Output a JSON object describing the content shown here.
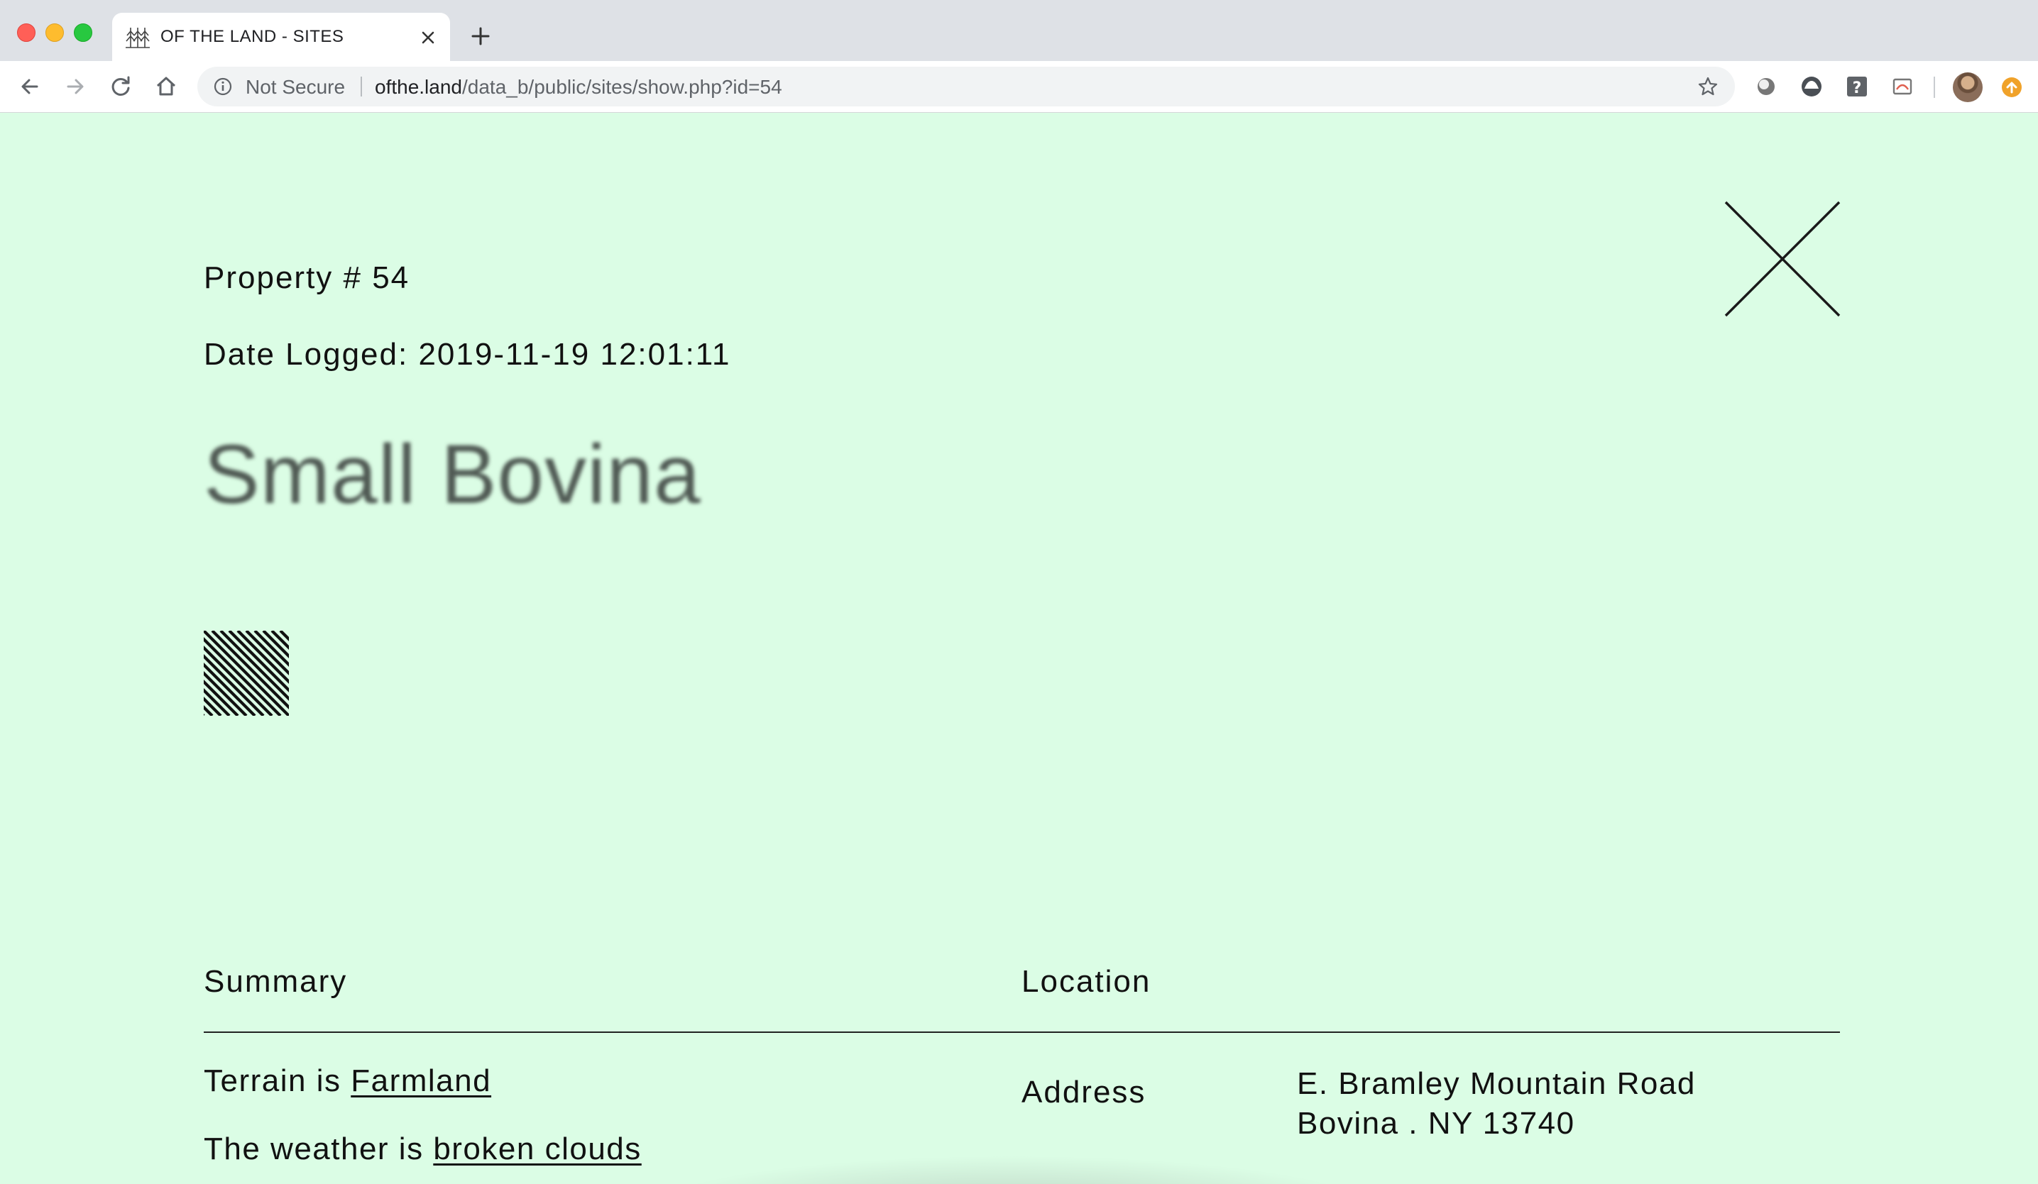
{
  "browser": {
    "tab": {
      "title": "OF THE LAND - SITES",
      "favicon": "trees-icon"
    },
    "omnibox": {
      "security_label": "Not Secure",
      "url_host": "ofthe.land",
      "url_path": "/data_b/public/sites/show.php?id=54"
    },
    "icons": [
      "back-icon",
      "forward-icon",
      "reload-icon",
      "home-icon",
      "info-icon",
      "star-icon",
      "close-tab-icon",
      "new-tab-icon",
      "extension-icon",
      "profile-avatar",
      "update-icon"
    ]
  },
  "page": {
    "background": "#dbfde5",
    "property_number": "Property # 54",
    "date_logged": "Date Logged: 2019-11-19 12:01:11",
    "site_name": "Small Bovina",
    "close_label_icon": "close-icon",
    "summary": {
      "heading": "Summary",
      "terrain_prefix": "Terrain is ",
      "terrain_value": "Farmland",
      "weather_prefix": "The weather is ",
      "weather_value": "broken clouds"
    },
    "location": {
      "heading": "Location",
      "address_label": "Address",
      "address_line1": "E. Bramley Mountain Road",
      "address_line2": "Bovina . NY 13740"
    }
  }
}
